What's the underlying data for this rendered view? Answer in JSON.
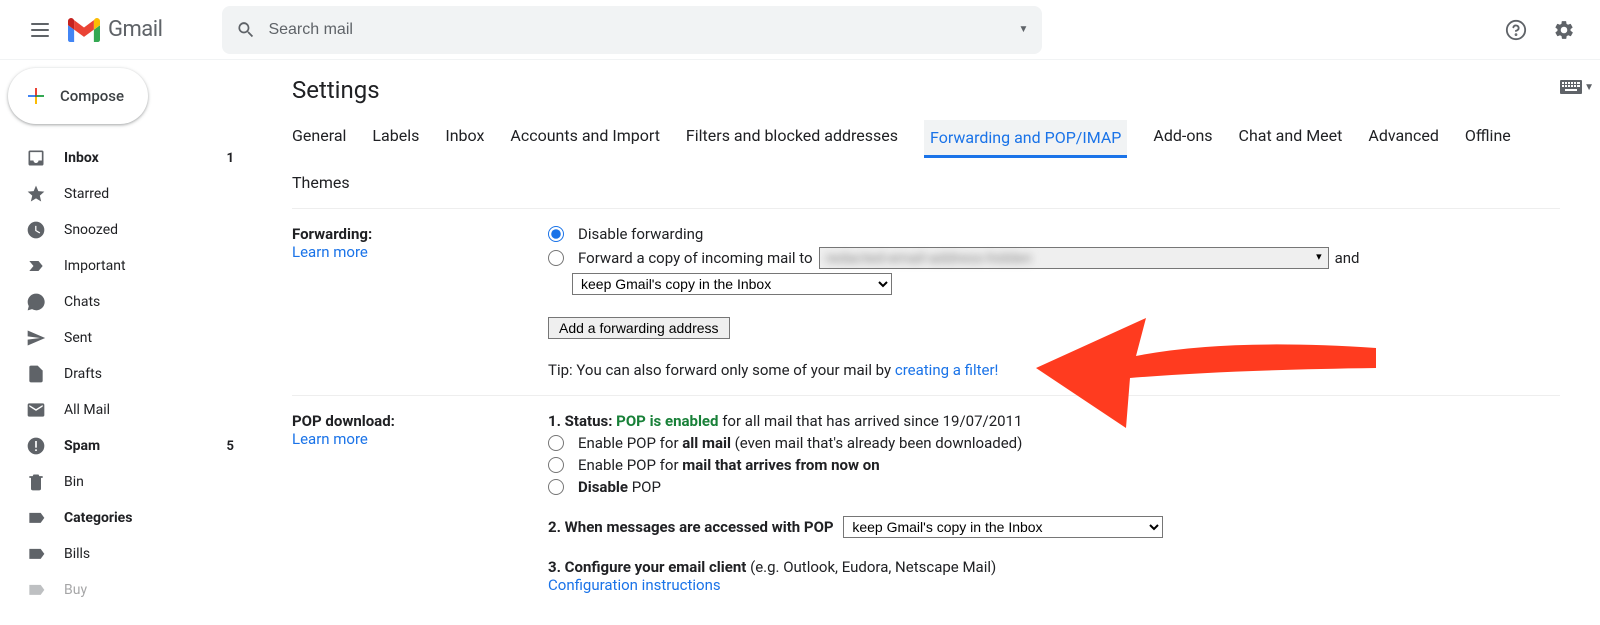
{
  "header": {
    "logo_text": "Gmail",
    "search_placeholder": "Search mail"
  },
  "sidebar": {
    "compose_label": "Compose",
    "items": [
      {
        "label": "Inbox",
        "count": "1",
        "bold": true,
        "icon": "inbox"
      },
      {
        "label": "Starred",
        "count": "",
        "bold": false,
        "icon": "star"
      },
      {
        "label": "Snoozed",
        "count": "",
        "bold": false,
        "icon": "clock"
      },
      {
        "label": "Important",
        "count": "",
        "bold": false,
        "icon": "important"
      },
      {
        "label": "Chats",
        "count": "",
        "bold": false,
        "icon": "chat"
      },
      {
        "label": "Sent",
        "count": "",
        "bold": false,
        "icon": "sent"
      },
      {
        "label": "Drafts",
        "count": "",
        "bold": false,
        "icon": "draft"
      },
      {
        "label": "All Mail",
        "count": "",
        "bold": false,
        "icon": "mail"
      },
      {
        "label": "Spam",
        "count": "5",
        "bold": true,
        "icon": "spam"
      },
      {
        "label": "Bin",
        "count": "",
        "bold": false,
        "icon": "bin"
      },
      {
        "label": "Categories",
        "count": "",
        "bold": true,
        "icon": "label"
      },
      {
        "label": "Bills",
        "count": "",
        "bold": false,
        "icon": "label"
      },
      {
        "label": "Buy",
        "count": "",
        "bold": false,
        "icon": "label"
      }
    ]
  },
  "content": {
    "title": "Settings",
    "tabs": [
      "General",
      "Labels",
      "Inbox",
      "Accounts and Import",
      "Filters and blocked addresses",
      "Forwarding and POP/IMAP",
      "Add-ons",
      "Chat and Meet",
      "Advanced",
      "Offline",
      "Themes"
    ],
    "active_tab": "Forwarding and POP/IMAP",
    "forwarding": {
      "label": "Forwarding:",
      "learn": "Learn more",
      "opt_disable": "Disable forwarding",
      "opt_forward_prefix": "Forward a copy of incoming mail to",
      "opt_forward_suffix": "and",
      "keep_option": "keep Gmail's copy in the Inbox",
      "add_btn": "Add a forwarding address",
      "tip": "Tip: You can also forward only some of your mail by ",
      "tip_link": "creating a filter!"
    },
    "pop": {
      "label": "POP download:",
      "learn": "Learn more",
      "status_prefix": "1. Status: ",
      "status_green": "POP is enabled",
      "status_suffix": " for all mail that has arrived since 19/07/2011",
      "opt_all_prefix": "Enable POP for ",
      "opt_all_bold": "all mail",
      "opt_all_suffix": " (even mail that's already been downloaded)",
      "opt_now_prefix": "Enable POP for ",
      "opt_now_bold": "mail that arrives from now on",
      "opt_disable_bold": "Disable",
      "opt_disable_suffix": " POP",
      "when_label": "2. When messages are accessed with POP",
      "when_option": "keep Gmail's copy in the Inbox",
      "configure_label": "3. Configure your email client",
      "configure_suffix": " (e.g. Outlook, Eudora, Netscape Mail)",
      "configure_link": "Configuration instructions"
    }
  }
}
